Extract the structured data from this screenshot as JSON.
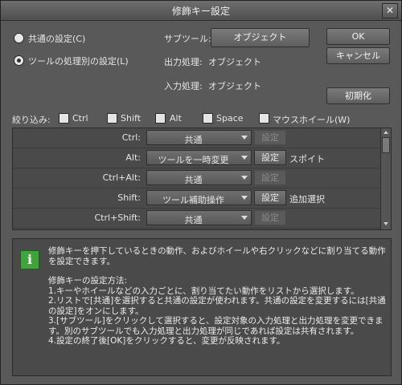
{
  "title": "修飾キー設定",
  "mode": {
    "common": "共通の設定(C)",
    "per_tool": "ツールの処理別の設定(L)",
    "selected": "per_tool"
  },
  "subtool": {
    "label": "サブツール:",
    "value": "オブジェクト"
  },
  "output": {
    "label": "出力処理:",
    "value": "オブジェクト"
  },
  "input": {
    "label": "入力処理:",
    "value": "オブジェクト"
  },
  "buttons": {
    "ok": "OK",
    "cancel": "キャンセル",
    "reset": "初期化"
  },
  "filter": {
    "label": "絞り込み:",
    "options": [
      "Ctrl",
      "Shift",
      "Alt",
      "Space",
      "マウスホイール(W)"
    ]
  },
  "rows": [
    {
      "key": "Ctrl:",
      "action": "共通",
      "set_enabled": false,
      "tool": ""
    },
    {
      "key": "Alt:",
      "action": "ツールを一時変更",
      "set_enabled": true,
      "tool": "スポイト"
    },
    {
      "key": "Ctrl+Alt:",
      "action": "共通",
      "set_enabled": false,
      "tool": ""
    },
    {
      "key": "Shift:",
      "action": "ツール補助操作",
      "set_enabled": true,
      "tool": "追加選択"
    },
    {
      "key": "Ctrl+Shift:",
      "action": "共通",
      "set_enabled": false,
      "tool": ""
    }
  ],
  "set_label": "設定",
  "info": {
    "lines": [
      "修飾キーを押下しているときの動作、およびホイールや右クリックなどに割り当てる動作を設定できます。",
      "",
      "修飾キーの設定方法:",
      "1.キーやホイールなどの入力ごとに、割り当てたい動作をリストから選択します。",
      "2.リストで[共通]を選択すると共通の設定が使われます。共通の設定を変更するには[共通の設定]をオンにします。",
      "3.[サブツール]をクリックして選択すると、設定対象の入力処理と出力処理を変更できます。別のサブツールでも入力処理と出力処理が同じであれば設定は共有されます。",
      "4.設定の終了後[OK]をクリックすると、変更が反映されます。"
    ]
  }
}
